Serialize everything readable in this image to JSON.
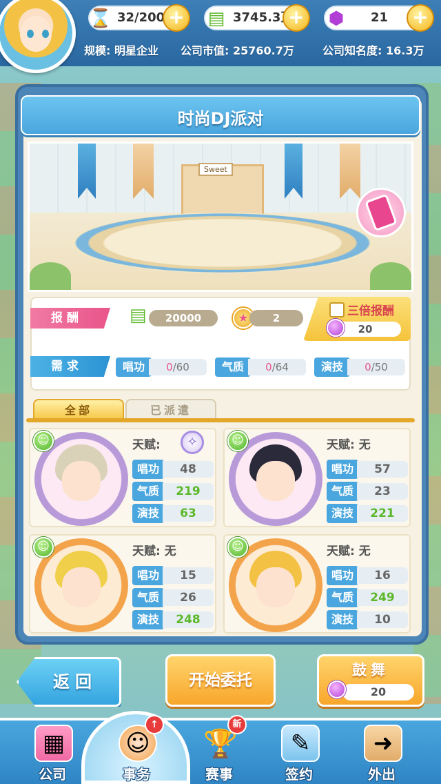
{
  "resources": {
    "energy": "32/200",
    "money": "3745.3万",
    "gems": "21"
  },
  "company": {
    "scale": "规模: 明星企业",
    "market_value": "公司市值: 25760.7万",
    "fame": "公司知名度: 16.3万"
  },
  "event": {
    "title": "时尚DJ派对",
    "scene_sign": "Sweet"
  },
  "reward": {
    "label": "报酬",
    "money": "20000",
    "medal": "2",
    "triple_label": "三倍报酬",
    "triple_cost": "20"
  },
  "requirement": {
    "label": "需求",
    "items": [
      {
        "name": "唱功",
        "current": "0",
        "total": "/60"
      },
      {
        "name": "气质",
        "current": "0",
        "total": "/64"
      },
      {
        "name": "演技",
        "current": "0",
        "total": "/50"
      }
    ]
  },
  "tabs": {
    "all": "全部",
    "dispatched": "已派遣"
  },
  "cards": [
    {
      "talent_label": "天赋:",
      "talent": "",
      "talent_icon": "talent-badge-icon",
      "singing": "48",
      "temperament": "219",
      "acting": "63"
    },
    {
      "talent_label": "天赋:",
      "talent": "无",
      "singing": "57",
      "temperament": "23",
      "acting": "221"
    },
    {
      "talent_label": "天赋:",
      "talent": "无",
      "singing": "15",
      "temperament": "26",
      "acting": "248"
    },
    {
      "talent_label": "天赋:",
      "talent": "无",
      "singing": "16",
      "temperament": "249",
      "acting": "10"
    }
  ],
  "stat_labels": {
    "singing": "唱功",
    "temperament": "气质",
    "acting": "演技"
  },
  "buttons": {
    "back": "返回",
    "start": "开始委托",
    "cheer": "鼓舞",
    "cheer_cost": "20"
  },
  "nav": [
    {
      "label": "公司",
      "icon": "building-icon"
    },
    {
      "label": "事务",
      "icon": "manager-icon",
      "badge": "↑"
    },
    {
      "label": "赛事",
      "icon": "trophy-icon",
      "badge": "新"
    },
    {
      "label": "签约",
      "icon": "contract-icon"
    },
    {
      "label": "外出",
      "icon": "door-icon"
    }
  ]
}
